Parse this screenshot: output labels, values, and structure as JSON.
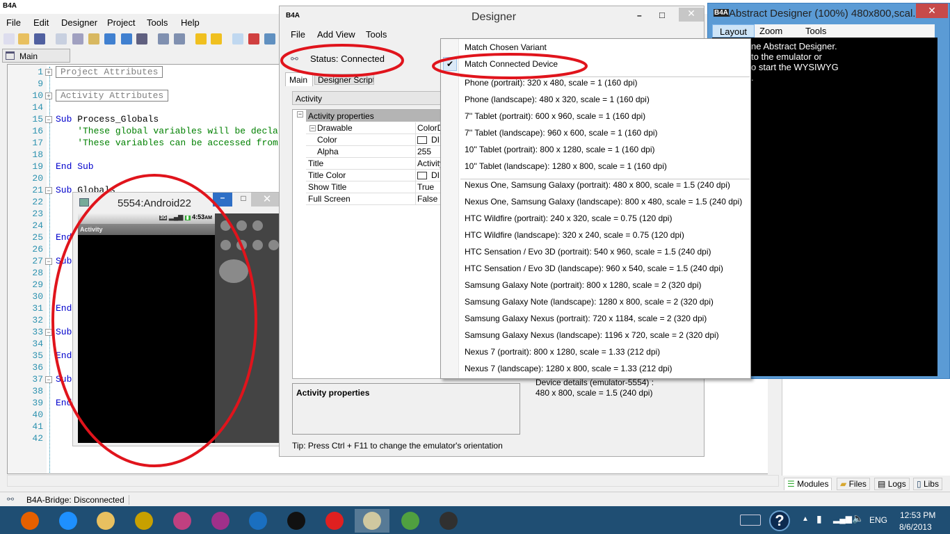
{
  "ide": {
    "logo": "B4A",
    "menu": [
      "File",
      "Edit",
      "Designer",
      "Project",
      "Tools",
      "Help"
    ],
    "module_tab": "Main",
    "lines": [
      {
        "n": "1",
        "t": "Project Attributes",
        "k": "region",
        "fold": "+"
      },
      {
        "n": "9",
        "t": ""
      },
      {
        "n": "10",
        "t": "Activity Attributes",
        "k": "region",
        "fold": "+"
      },
      {
        "n": "14",
        "t": ""
      },
      {
        "n": "15",
        "t": "Sub Process_Globals",
        "k": "sub",
        "fold": "-"
      },
      {
        "n": "16",
        "t": "    'These global variables will be declared once when the application starts.",
        "k": "cm"
      },
      {
        "n": "17",
        "t": "    'These variables can be accessed from all modules.",
        "k": "cm"
      },
      {
        "n": "18",
        "t": ""
      },
      {
        "n": "19",
        "t": "End Sub",
        "k": "kw"
      },
      {
        "n": "20",
        "t": ""
      },
      {
        "n": "21",
        "t": "Sub Globals",
        "k": "sub",
        "fold": "-"
      },
      {
        "n": "22",
        "t": ""
      },
      {
        "n": "23",
        "t": ""
      },
      {
        "n": "24",
        "t": ""
      },
      {
        "n": "25",
        "t": "End Sub",
        "k": "kw"
      },
      {
        "n": "26",
        "t": ""
      },
      {
        "n": "27",
        "t": "Sub",
        "k": "kw",
        "fold": "-"
      },
      {
        "n": "28",
        "t": ""
      },
      {
        "n": "29",
        "t": ""
      },
      {
        "n": "30",
        "t": ""
      },
      {
        "n": "31",
        "t": "End Sub",
        "k": "kw"
      },
      {
        "n": "32",
        "t": ""
      },
      {
        "n": "33",
        "t": "Sub",
        "k": "kw",
        "fold": "-"
      },
      {
        "n": "34",
        "t": ""
      },
      {
        "n": "35",
        "t": "End Sub",
        "k": "kw"
      },
      {
        "n": "36",
        "t": ""
      },
      {
        "n": "37",
        "t": "Sub",
        "k": "kw",
        "fold": "-"
      },
      {
        "n": "38",
        "t": ""
      },
      {
        "n": "39",
        "t": "End Sub",
        "k": "kw"
      },
      {
        "n": "40",
        "t": ""
      },
      {
        "n": "41",
        "t": ""
      },
      {
        "n": "42",
        "t": ""
      }
    ],
    "bottom_tabs": [
      "Modules",
      "Files",
      "Logs",
      "Libs"
    ],
    "status": "B4A-Bridge: Disconnected"
  },
  "designer": {
    "logo": "B4A",
    "title": "Designer",
    "menu": [
      "File",
      "Add View",
      "Tools"
    ],
    "status": "Status: Connected",
    "tabs": [
      "Main",
      "Designer Scripts"
    ],
    "activity_combo": "Activity",
    "category": "Activity properties",
    "props": [
      {
        "k": "Drawable",
        "v": "ColorDr"
      },
      {
        "k": "Color",
        "v": "DI"
      },
      {
        "k": "Alpha",
        "v": "255"
      },
      {
        "k": "Title",
        "v": "Activity"
      },
      {
        "k": "Title Color",
        "v": "DI"
      },
      {
        "k": "Show Title",
        "v": "True"
      },
      {
        "k": "Full Screen",
        "v": "False"
      }
    ],
    "desc_title": "Activity properties",
    "device_details_1": "Device details (emulator-5554) :",
    "device_details_2": "480 x 800, scale = 1.5 (240 dpi)",
    "tip": "Tip: Press Ctrl + F11 to change the emulator's orientation"
  },
  "dropdown": {
    "checked": "Match Connected Device",
    "items": [
      "Match Chosen Variant",
      "Match Connected Device",
      "Phone (portrait): 320 x 480, scale = 1 (160 dpi)",
      "Phone (landscape): 480 x 320, scale = 1 (160 dpi)",
      "7'' Tablet (portrait): 600 x 960, scale = 1 (160 dpi)",
      "7'' Tablet (landscape): 960 x 600, scale = 1 (160 dpi)",
      "10'' Tablet (portrait): 800 x 1280, scale = 1 (160 dpi)",
      "10'' Tablet (landscape): 1280 x 800, scale = 1 (160 dpi)",
      "Nexus One, Samsung Galaxy (portrait): 480 x 800, scale = 1.5 (240 dpi)",
      "Nexus One, Samsung Galaxy (landscape): 800 x 480, scale = 1.5 (240 dpi)",
      "HTC Wildfire (portrait): 240 x 320, scale = 0.75 (120 dpi)",
      "HTC Wildfire (landscape): 320 x 240, scale = 0.75 (120 dpi)",
      "HTC Sensation / Evo 3D (portrait): 540 x 960, scale = 1.5 (240 dpi)",
      "HTC Sensation / Evo 3D (landscape): 960 x 540, scale = 1.5 (240 dpi)",
      "Samsung Galaxy Note (portrait): 800 x 1280, scale = 2 (320 dpi)",
      "Samsung Galaxy Note (landscape): 1280 x 800, scale = 2 (320 dpi)",
      "Samsung Galaxy Nexus (portrait): 720 x 1184, scale = 2 (320 dpi)",
      "Samsung Galaxy Nexus (landscape): 1196 x 720, scale = 2 (320 dpi)",
      "Nexus 7 (portrait): 800 x 1280, scale = 1.33 (212 dpi)",
      "Nexus 7 (landscape): 1280 x 800, scale = 1.33 (212 dpi)"
    ]
  },
  "abstract": {
    "logo": "B4A",
    "title": "Abstract Designer (100%) 480x800,scal...",
    "menu": [
      "Layout",
      "Zoom",
      "Tools"
    ],
    "text": [
      "ne Abstract Designer.",
      "to the emulator or",
      "o start the WYSIWYG",
      "."
    ]
  },
  "emulator": {
    "title": "5554:Android22",
    "clock": "4:53",
    "ampm": "AM",
    "network": "3G",
    "activity_title": "Activity"
  },
  "taskbar": {
    "lang": "ENG",
    "time": "12:53 PM",
    "date": "8/6/2013",
    "apps": [
      "firefox",
      "internet-explorer",
      "file-explorer",
      "media-player",
      "puzzle-app",
      "remote-desktop",
      "hp",
      "command-prompt",
      "flash-app",
      "basic4android",
      "download-app",
      "android-sdk"
    ],
    "app_colors": [
      "#e66000",
      "#1e90ff",
      "#e8c060",
      "#c8a000",
      "#c04080",
      "#a0308a",
      "#1a6fc0",
      "#111111",
      "#e02020",
      "#d0c8a0",
      "#50a040",
      "#303030"
    ]
  },
  "colors": {
    "highlight_ring": "#e0141c",
    "title_blue": "#5b9bd5",
    "taskbar": "#1f4e73"
  }
}
